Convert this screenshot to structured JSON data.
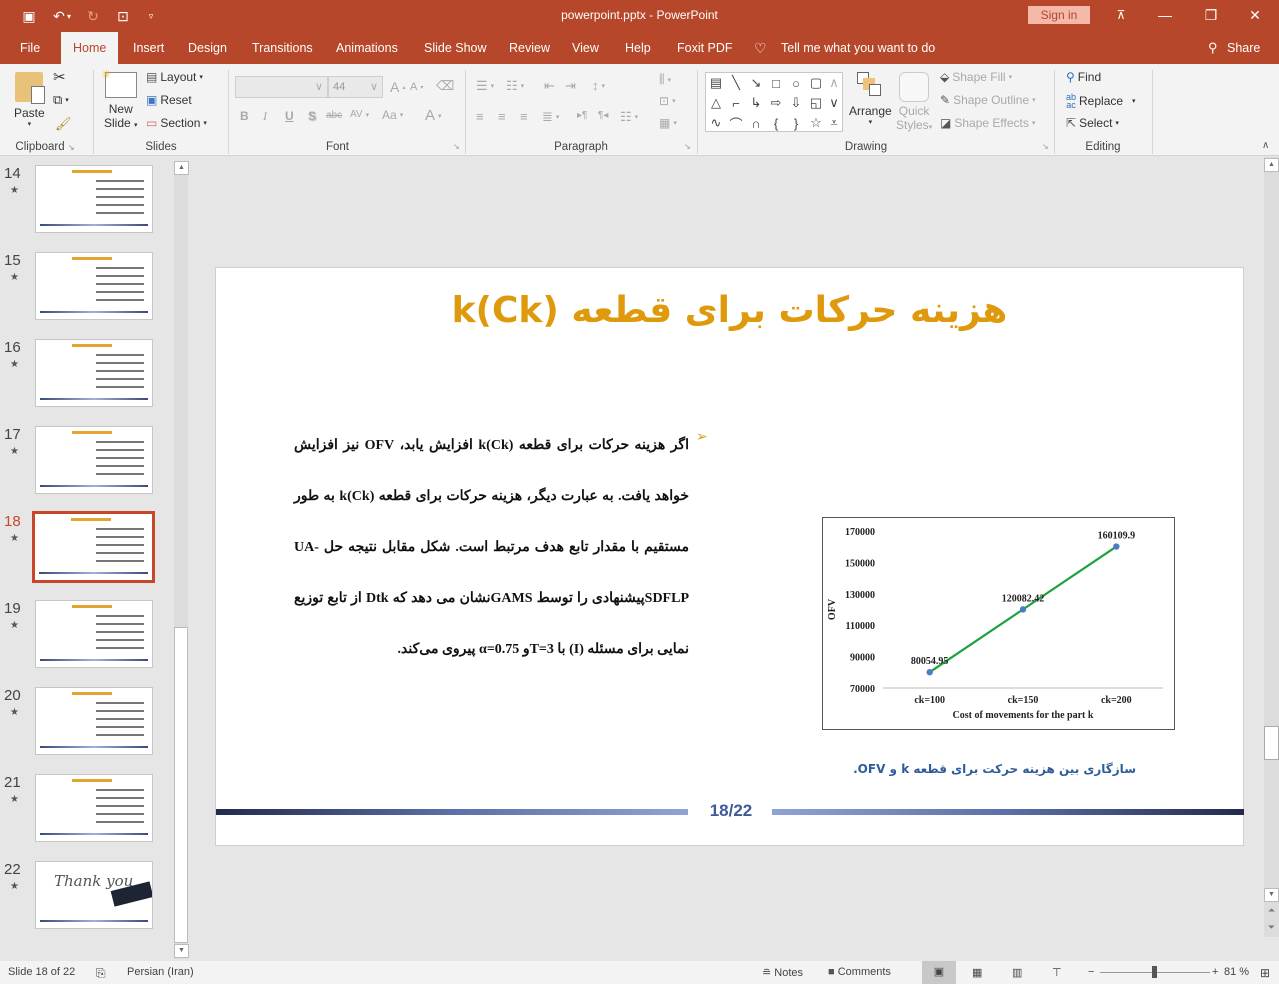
{
  "titlebar": {
    "title": "powerpoint.pptx  -  PowerPoint",
    "sign_in": "Sign in",
    "qat": {
      "save": "save-icon",
      "undo": "undo-icon",
      "redo": "redo-icon",
      "present": "present-icon",
      "customize": "customize-icon"
    }
  },
  "tabs": [
    "File",
    "Home",
    "Insert",
    "Design",
    "Transitions",
    "Animations",
    "Slide Show",
    "Review",
    "View",
    "Help",
    "Foxit PDF"
  ],
  "active_tab": "Home",
  "tell_me": "Tell me what you want to do",
  "share": "Share",
  "ribbon": {
    "clipboard": {
      "label": "Clipboard",
      "paste": "Paste"
    },
    "slides": {
      "label": "Slides",
      "new_slide_1": "New",
      "new_slide_2": "Slide",
      "layout": "Layout",
      "reset": "Reset",
      "section": "Section"
    },
    "font": {
      "label": "Font",
      "font_name": "",
      "font_size": "44",
      "bold": "B",
      "italic": "I",
      "underline": "U",
      "shadow": "S",
      "strike": "abc",
      "spacing": "AV",
      "case": "Aa",
      "color": "A"
    },
    "paragraph": {
      "label": "Paragraph"
    },
    "drawing": {
      "label": "Drawing",
      "arrange": "Arrange",
      "quick_1": "Quick",
      "quick_2": "Styles",
      "shape_fill": "Shape Fill",
      "shape_outline": "Shape Outline",
      "shape_effects": "Shape Effects"
    },
    "editing": {
      "label": "Editing",
      "find": "Find",
      "replace": "Replace",
      "select": "Select"
    }
  },
  "thumbnails": [
    {
      "num": "14",
      "selected": false
    },
    {
      "num": "15",
      "selected": false
    },
    {
      "num": "16",
      "selected": false
    },
    {
      "num": "17",
      "selected": false
    },
    {
      "num": "18",
      "selected": true
    },
    {
      "num": "19",
      "selected": false
    },
    {
      "num": "20",
      "selected": false
    },
    {
      "num": "21",
      "selected": false
    },
    {
      "num": "22",
      "selected": false,
      "text": "Thank you"
    }
  ],
  "slide": {
    "title": "هزینه حرکات برای قطعه (k(Ck",
    "body": "اگر هزینه حرکات برای قطعه  k(Ck) افزایش یابد، OFV نیز افزایش خواهد یافت. به عبارت دیگر، هزینه حرکات برای قطعه k(Ck) به طور مستقیم با مقدار تابع هدف مرتبط است. شکل مقابل نتیجه حل  UA-SDFLPپیشنهادی را توسط   GAMSنشان می دهد که Dtk از تابع توزیع نمایی برای مسئله (I) با  T=3و  α=0.75 پیروی می‌کند.",
    "caption": "سازگاری بین هزینه حرکت برای قطعه  k و OFV.",
    "page": "18/22"
  },
  "chart_data": {
    "type": "line",
    "categories": [
      "ck=100",
      "ck=150",
      "ck=200"
    ],
    "series": [
      {
        "name": "OFV",
        "values": [
          80054.95,
          120082.42,
          160109.9
        ],
        "color": "#1aa33c",
        "marker_color": "#4a7cc7"
      }
    ],
    "data_labels": [
      "80054.95",
      "120082.42",
      "160109.9"
    ],
    "xlabel": "Cost of movements for the part k",
    "ylabel": "OFV",
    "ylim": [
      70000,
      170000
    ],
    "yticks": [
      70000,
      90000,
      110000,
      130000,
      150000,
      170000
    ],
    "ytick_labels": [
      "70000",
      "90000",
      "110000",
      "130000",
      "150000",
      "170000"
    ],
    "grid": false
  },
  "statusbar": {
    "slide_info": "Slide 18 of 22",
    "language": "Persian (Iran)",
    "notes": "Notes",
    "comments": "Comments",
    "zoom": "81 %",
    "zoom_level": 0.81
  }
}
